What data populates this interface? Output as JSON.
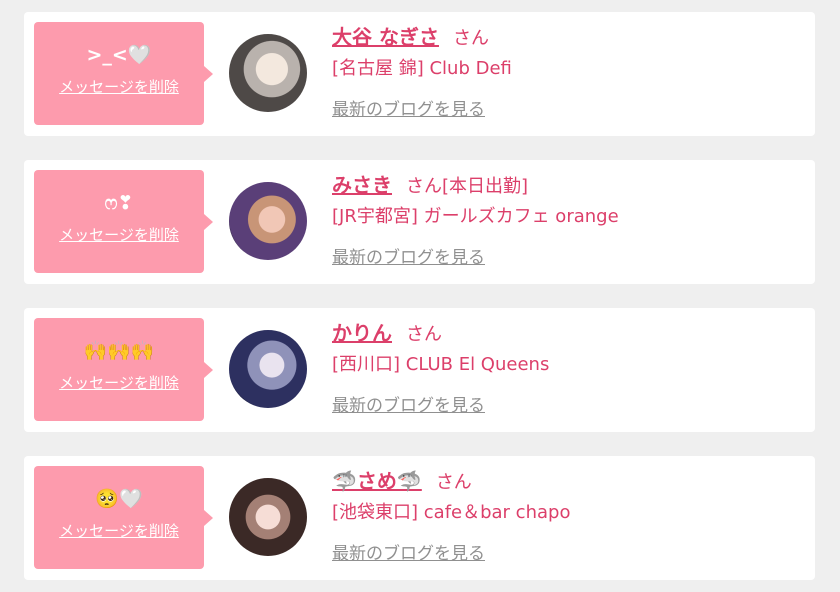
{
  "items": [
    {
      "message": ">_<🤍",
      "delete_label": "メッセージを削除",
      "name": "大谷 なぎさ",
      "honorific": "さん",
      "status": "",
      "shop": "[名古屋 錦] Club Defi",
      "blog_link": "最新のブログを見る"
    },
    {
      "message": "ෆ❣",
      "delete_label": "メッセージを削除",
      "name": "みさき",
      "honorific": "さん",
      "status": "[本日出勤]",
      "shop": "[JR宇都宮] ガールズカフェ orange",
      "blog_link": "最新のブログを見る"
    },
    {
      "message": "🙌🙌🙌",
      "delete_label": "メッセージを削除",
      "name": "かりん",
      "honorific": "さん",
      "status": "",
      "shop": "[西川口] CLUB El Queens",
      "blog_link": "最新のブログを見る"
    },
    {
      "message": "🥺🤍",
      "delete_label": "メッセージを削除",
      "name": "🦈さめ🦈",
      "honorific": "さん",
      "status": "",
      "shop": "[池袋東口] cafe＆bar chapo",
      "blog_link": "最新のブログを見る"
    }
  ],
  "colors": {
    "accent_pink": "#dc3f6a",
    "bubble_pink": "#fd9bad",
    "link_gray": "#909090",
    "background": "#efefef"
  }
}
